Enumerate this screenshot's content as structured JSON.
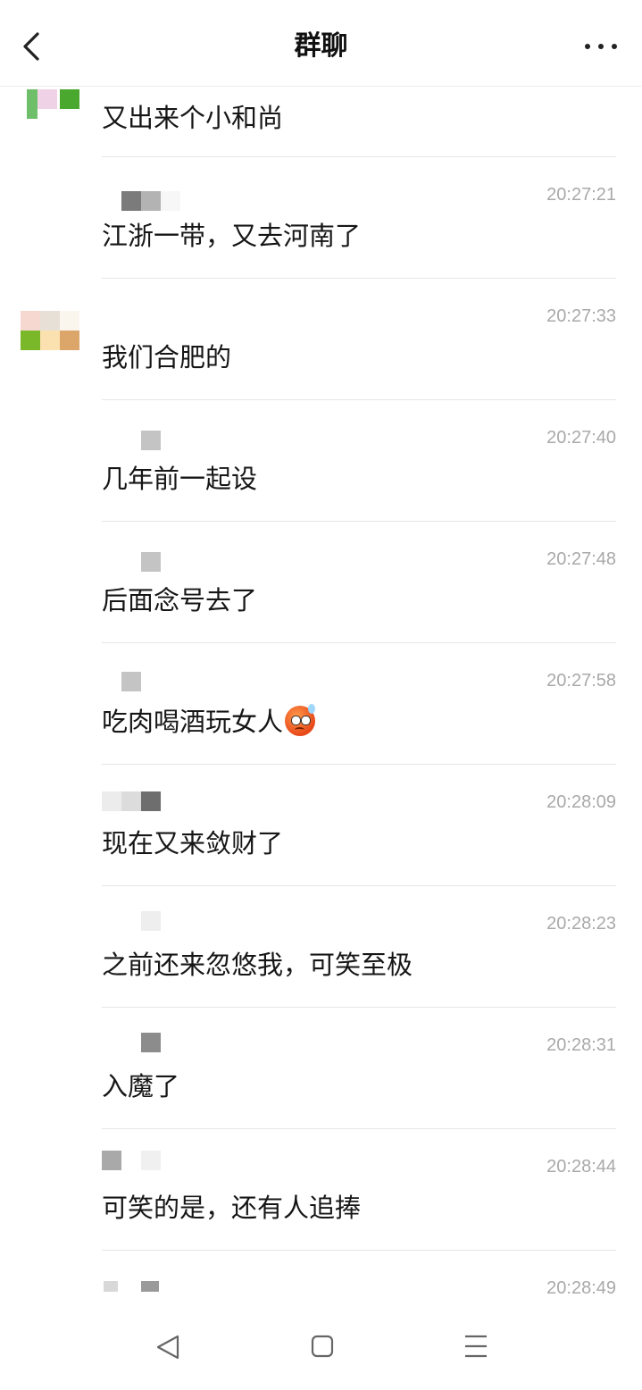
{
  "header": {
    "title": "群聊"
  },
  "messages": [
    {
      "time": "",
      "text": "又出来个小和尚"
    },
    {
      "time": "20:27:21",
      "text": "江浙一带，又去河南了"
    },
    {
      "time": "20:27:33",
      "text": "我们合肥的"
    },
    {
      "time": "20:27:40",
      "text": "几年前一起设"
    },
    {
      "time": "20:27:48",
      "text": "后面念号去了"
    },
    {
      "time": "20:27:58",
      "text": "吃肉喝酒玩女人",
      "emoji": "anxious-sweat-face"
    },
    {
      "time": "20:28:09",
      "text": "现在又来敛财了"
    },
    {
      "time": "20:28:23",
      "text": "之前还来忽悠我，可笑至极"
    },
    {
      "time": "20:28:31",
      "text": "入魔了"
    },
    {
      "time": "20:28:44",
      "text": "可笑的是，还有人追捧"
    },
    {
      "time": "20:28:49",
      "text": ""
    }
  ],
  "nav": {
    "icons": [
      "back-triangle-icon",
      "home-square-icon",
      "menu-lines-icon"
    ]
  }
}
